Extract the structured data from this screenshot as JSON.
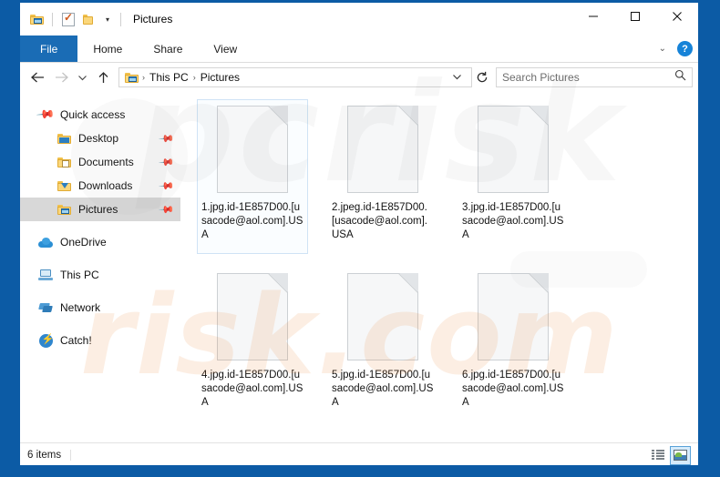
{
  "window": {
    "title": "Pictures",
    "quick_access_toolbar": [
      {
        "name": "pictures-folder-icon",
        "label": "Pictures"
      },
      {
        "name": "properties-icon",
        "label": "Properties"
      },
      {
        "name": "new-folder-icon",
        "label": "New folder"
      },
      {
        "name": "customize-dropdown-icon",
        "label": "▾"
      }
    ],
    "controls": {
      "minimize": "—",
      "maximize": "□",
      "close": "✕"
    },
    "border_color": "#0c5ba5"
  },
  "ribbon": {
    "tabs": [
      {
        "label": "File",
        "active": true
      },
      {
        "label": "Home",
        "active": false
      },
      {
        "label": "Share",
        "active": false
      },
      {
        "label": "View",
        "active": false
      }
    ],
    "expand_label": "⌄",
    "help_label": "?"
  },
  "address_bar": {
    "back_label": "←",
    "forward_label": "→",
    "recent_label": "⌄",
    "up_label": "↑",
    "breadcrumb": [
      "This PC",
      "Pictures"
    ],
    "breadcrumb_separator": "›",
    "breadcrumb_dropdown": "⌄",
    "refresh_label": "↻"
  },
  "search": {
    "placeholder": "Search Pictures",
    "icon": "search-icon"
  },
  "sidebar": {
    "items": [
      {
        "label": "Quick access",
        "icon": "pin-icon",
        "level": 0,
        "pinned": false,
        "selected": false
      },
      {
        "label": "Desktop",
        "icon": "desktop-folder-icon",
        "level": 1,
        "pinned": true,
        "selected": false
      },
      {
        "label": "Documents",
        "icon": "documents-folder-icon",
        "level": 1,
        "pinned": true,
        "selected": false
      },
      {
        "label": "Downloads",
        "icon": "downloads-folder-icon",
        "level": 1,
        "pinned": true,
        "selected": false
      },
      {
        "label": "Pictures",
        "icon": "pictures-folder-icon",
        "level": 1,
        "pinned": true,
        "selected": true
      },
      {
        "label": "OneDrive",
        "icon": "cloud-icon",
        "level": 0,
        "pinned": false,
        "selected": false
      },
      {
        "label": "This PC",
        "icon": "computer-icon",
        "level": 0,
        "pinned": false,
        "selected": false
      },
      {
        "label": "Network",
        "icon": "network-icon",
        "level": 0,
        "pinned": false,
        "selected": false
      },
      {
        "label": "Catch!",
        "icon": "catch-icon",
        "level": 0,
        "pinned": false,
        "selected": false
      }
    ]
  },
  "files": [
    {
      "name": "1.jpg.id-1E857D00.[usacode@aol.com].USA",
      "icon": "blank-file-icon",
      "focused": true
    },
    {
      "name": "2.jpeg.id-1E857D00.[usacode@aol.com].USA",
      "icon": "blank-file-icon",
      "focused": false
    },
    {
      "name": "3.jpg.id-1E857D00.[usacode@aol.com].USA",
      "icon": "blank-file-icon",
      "focused": false
    },
    {
      "name": "4.jpg.id-1E857D00.[usacode@aol.com].USA",
      "icon": "blank-file-icon",
      "focused": false
    },
    {
      "name": "5.jpg.id-1E857D00.[usacode@aol.com].USA",
      "icon": "blank-file-icon",
      "focused": false
    },
    {
      "name": "6.jpg.id-1E857D00.[usacode@aol.com].USA",
      "icon": "blank-file-icon",
      "focused": false
    }
  ],
  "status_bar": {
    "item_count": "6 items",
    "views": [
      {
        "name": "details-view-button",
        "active": false
      },
      {
        "name": "large-icons-view-button",
        "active": true
      }
    ]
  },
  "watermark": {
    "main_text": "risk.com",
    "ghost_text": "pcrisk"
  }
}
